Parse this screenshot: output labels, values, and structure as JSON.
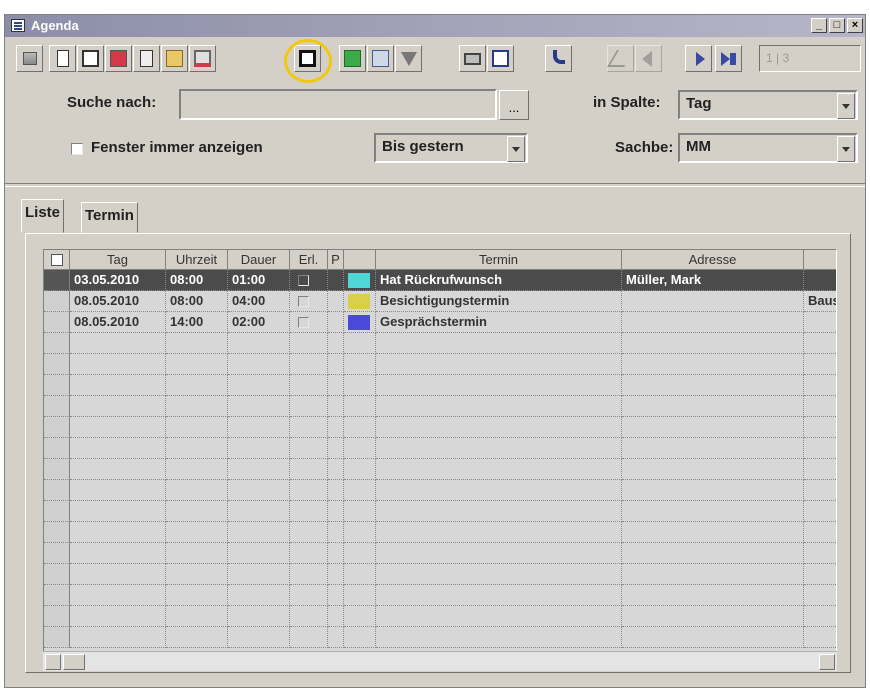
{
  "window": {
    "title": "Agenda",
    "minimize": "_",
    "maximize": "□",
    "close": "×"
  },
  "toolbar": {
    "buttons": [
      "exit-icon",
      "new-document-icon",
      "save-icon",
      "edit-icon",
      "notes-icon",
      "folder-open-icon",
      "monitor-icon",
      "save-as-icon",
      "export-icon",
      "sort-az-icon",
      "filter-icon",
      "print-icon",
      "help-icon",
      "phone-icon",
      "first-record-icon",
      "previous-record-icon",
      "next-record-icon",
      "last-record-icon"
    ],
    "pager": "1 | 3",
    "highlight_color": "#f0c814"
  },
  "search": {
    "label": "Suche nach:",
    "value": "",
    "browse": "..."
  },
  "column_filter": {
    "label": "in Spalte:",
    "value": "Tag"
  },
  "show_window": {
    "label": "Fenster immer anzeigen",
    "checked": false
  },
  "range": {
    "value": "Bis gestern"
  },
  "sachbe": {
    "label": "Sachbe:",
    "value": "MM"
  },
  "tabs": [
    {
      "label": "Liste",
      "active": true
    },
    {
      "label": "Termin",
      "active": false
    }
  ],
  "table": {
    "columns": [
      "Tag",
      "Uhrzeit",
      "Dauer",
      "Erl.",
      "P",
      "",
      "Termin",
      "Adresse",
      ""
    ],
    "rows": [
      {
        "tag": "03.05.2010",
        "uhrzeit": "08:00",
        "dauer": "01:00",
        "erl": false,
        "color": "#4fd6d6",
        "termin": "Hat Rückrufwunsch",
        "adresse": "Müller, Mark",
        "extra": "",
        "selected": true
      },
      {
        "tag": "08.05.2010",
        "uhrzeit": "08:00",
        "dauer": "04:00",
        "erl": false,
        "color": "#d8d04a",
        "termin": "Besichtigungstermin",
        "adresse": "",
        "extra": "Baust",
        "selected": false
      },
      {
        "tag": "08.05.2010",
        "uhrzeit": "14:00",
        "dauer": "02:00",
        "erl": false,
        "color": "#4a4ad8",
        "termin": "Gesprächstermin",
        "adresse": "",
        "extra": "",
        "selected": false
      }
    ]
  }
}
